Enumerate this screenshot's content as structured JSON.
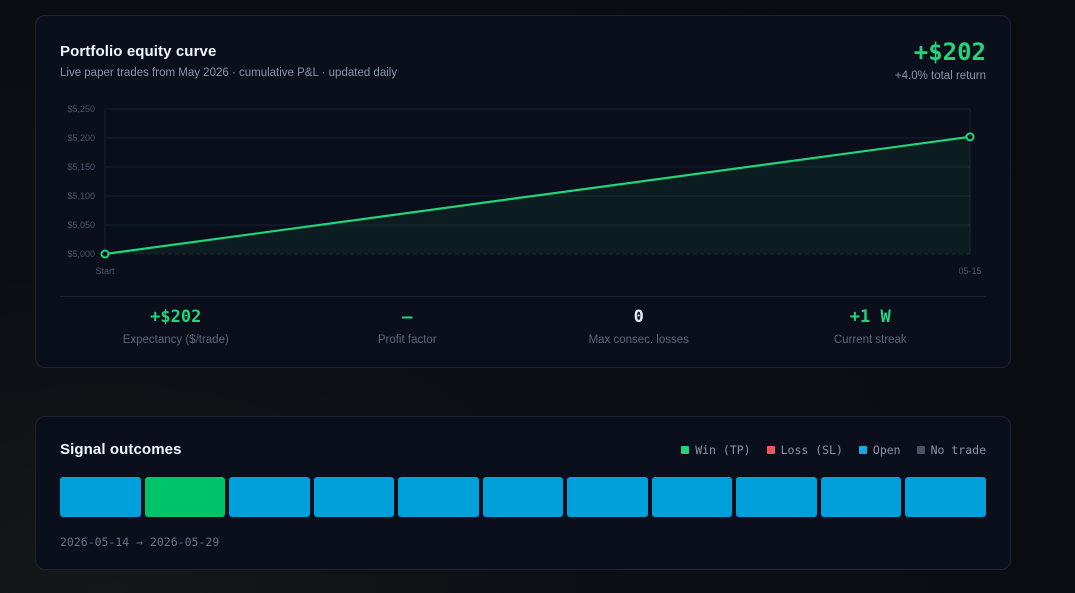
{
  "equity": {
    "title": "Portfolio equity curve",
    "subtitle": "Live paper trades from May 2026 · cumulative P&L · updated daily",
    "total_pnl": "+$202",
    "total_return": "+4.0% total return"
  },
  "chart_data": {
    "type": "area",
    "x": [
      "Start",
      "05-15"
    ],
    "values": [
      5000,
      5202
    ],
    "ylim": [
      5000,
      5250
    ],
    "yticks": [
      5000,
      5050,
      5100,
      5150,
      5200,
      5250
    ],
    "ytick_labels": [
      "$5,000",
      "$5,050",
      "$5,100",
      "$5,150",
      "$5,200",
      "$5,250"
    ],
    "grid": true,
    "line_color": "#22d47a"
  },
  "stats": [
    {
      "value": "+$202",
      "label": "Expectancy ($/trade)",
      "tone": "green"
    },
    {
      "value": "—",
      "label": "Profit factor",
      "tone": "green"
    },
    {
      "value": "0",
      "label": "Max consec. losses",
      "tone": "white"
    },
    {
      "value": "+1 W",
      "label": "Current streak",
      "tone": "green"
    }
  ],
  "outcomes": {
    "title": "Signal outcomes",
    "legend": [
      {
        "label": "Win (TP)",
        "color": "#22d47a"
      },
      {
        "label": "Loss (SL)",
        "color": "#f0555f"
      },
      {
        "label": "Open",
        "color": "#1aa7e6"
      },
      {
        "label": "No trade",
        "color": "#4a5163"
      }
    ],
    "cells": [
      "open",
      "win",
      "open",
      "open",
      "open",
      "open",
      "open",
      "open",
      "open",
      "open",
      "open"
    ],
    "cell_colors": {
      "win": "#00c46a",
      "loss": "#f0555f",
      "open": "#00a0db",
      "none": "#4a5163"
    },
    "range": "2026-05-14 → 2026-05-29"
  }
}
